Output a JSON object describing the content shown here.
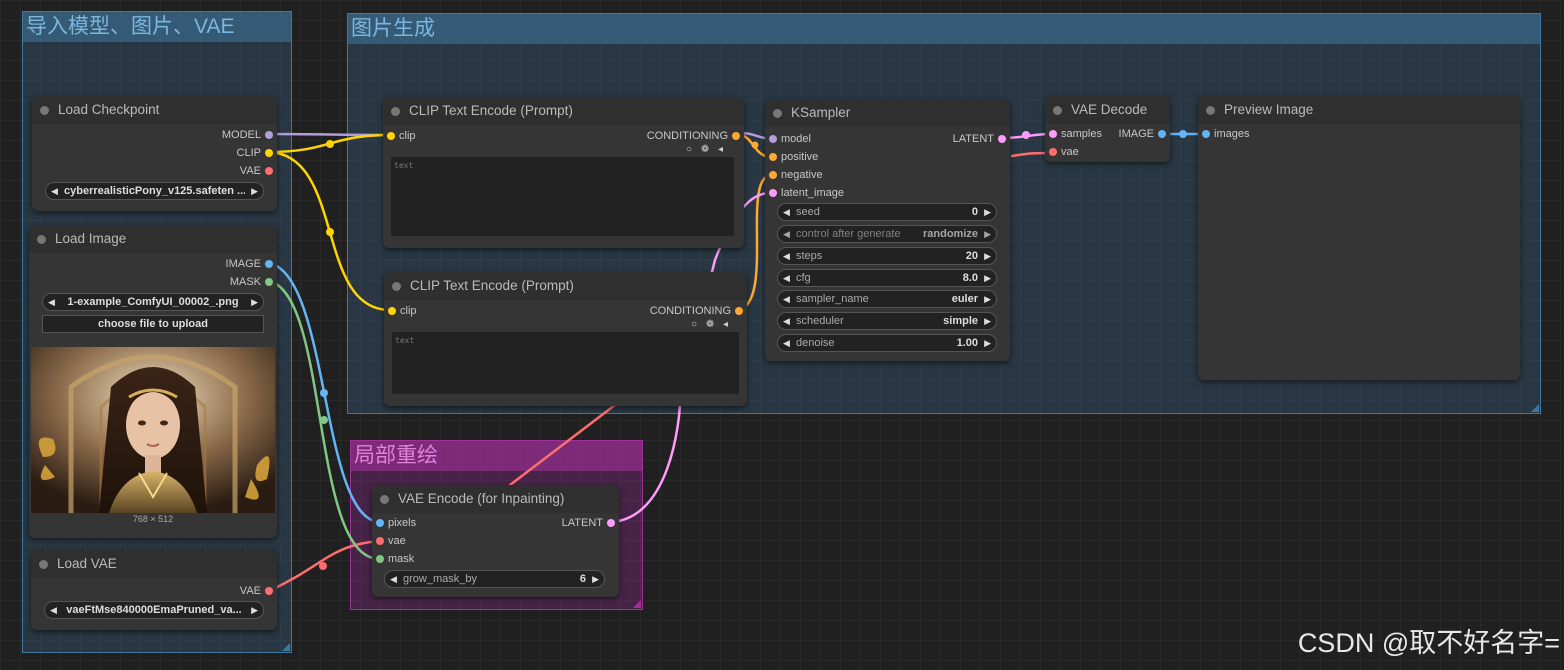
{
  "groups": {
    "load": {
      "title": "导入模型、图片、VAE"
    },
    "gen": {
      "title": "图片生成"
    },
    "inpaint": {
      "title": "局部重绘"
    }
  },
  "nodes": {
    "load_checkpoint": {
      "title": "Load Checkpoint",
      "outputs": [
        "MODEL",
        "CLIP",
        "VAE"
      ],
      "ckpt_name": "cyberrealisticPony_v125.safeten ..."
    },
    "load_image": {
      "title": "Load Image",
      "outputs": [
        "IMAGE",
        "MASK"
      ],
      "image": "1-example_ComfyUI_00002_.png",
      "upload_label": "choose file to upload",
      "image_size": "768 × 512"
    },
    "load_vae": {
      "title": "Load VAE",
      "outputs": [
        "VAE"
      ],
      "vae_name": "vaeFtMse840000EmaPruned_va..."
    },
    "clip_pos": {
      "title": "CLIP Text Encode (Prompt)",
      "input": "clip",
      "output": "CONDITIONING",
      "text": "text"
    },
    "clip_neg": {
      "title": "CLIP Text Encode (Prompt)",
      "input": "clip",
      "output": "CONDITIONING",
      "text": "text"
    },
    "ksampler": {
      "title": "KSampler",
      "inputs": [
        "model",
        "positive",
        "negative",
        "latent_image"
      ],
      "output": "LATENT",
      "widgets": [
        {
          "label": "seed",
          "value": "0"
        },
        {
          "label": "control after generate",
          "value": "randomize"
        },
        {
          "label": "steps",
          "value": "20"
        },
        {
          "label": "cfg",
          "value": "8.0"
        },
        {
          "label": "sampler_name",
          "value": "euler"
        },
        {
          "label": "scheduler",
          "value": "simple"
        },
        {
          "label": "denoise",
          "value": "1.00"
        }
      ]
    },
    "vae_decode": {
      "title": "VAE Decode",
      "inputs": [
        "samples",
        "vae"
      ],
      "output": "IMAGE"
    },
    "preview": {
      "title": "Preview Image",
      "input": "images"
    },
    "vae_encode": {
      "title": "VAE Encode (for Inpainting)",
      "inputs": [
        "pixels",
        "vae",
        "mask"
      ],
      "output": "LATENT",
      "grow_label": "grow_mask_by",
      "grow_value": "6"
    }
  },
  "slot_colors": {
    "MODEL": "#b39ddb",
    "CLIP": "#ffd500",
    "VAE": "#ff6e6e",
    "IMAGE": "#64b5f6",
    "MASK": "#81c784",
    "CONDITIONING": "#ffa931",
    "LATENT": "#ff9cf9"
  },
  "watermark": "CSDN @取不好名字="
}
